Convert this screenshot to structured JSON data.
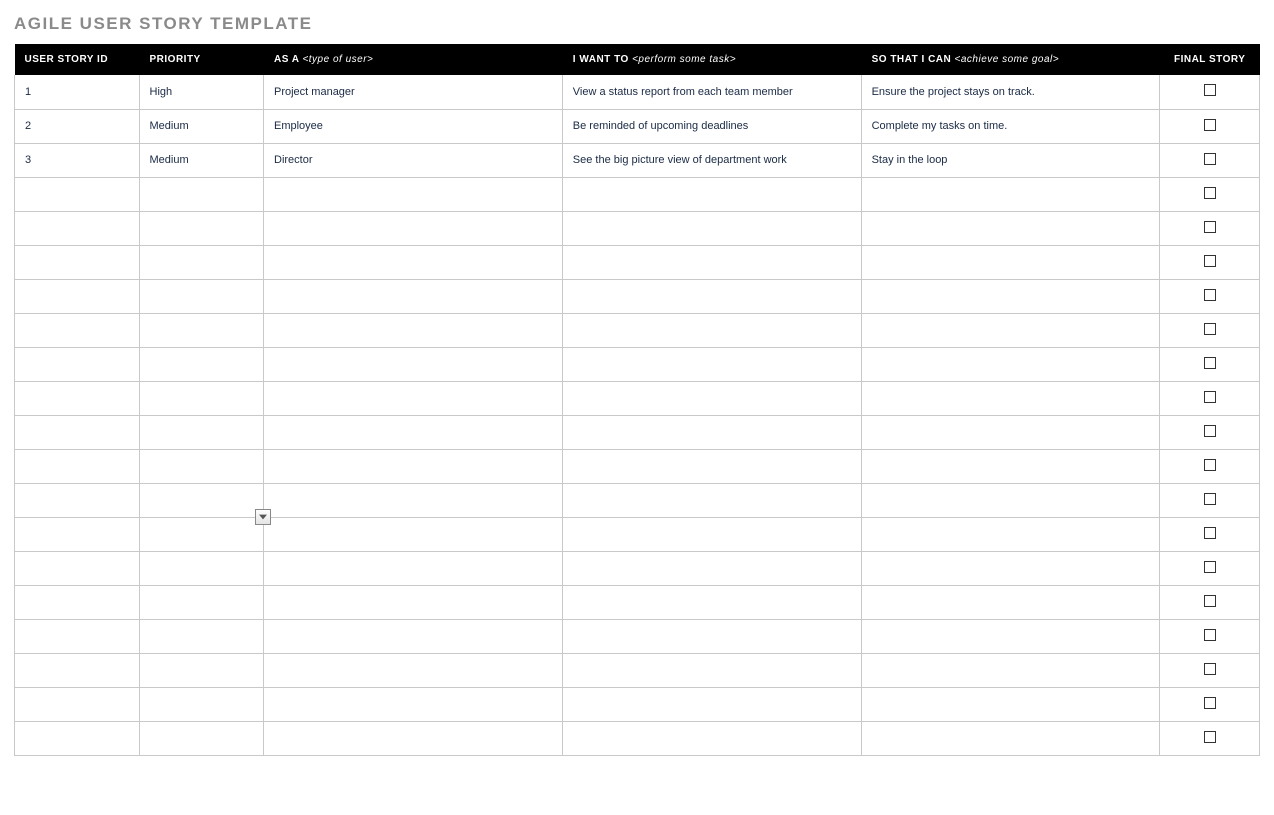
{
  "title": "AGILE USER STORY TEMPLATE",
  "headers": {
    "id": "USER STORY ID",
    "priority": "PRIORITY",
    "asa_label": "AS A ",
    "asa_hint": "<type of user>",
    "want_label": "I WANT TO ",
    "want_hint": "<perform some task>",
    "goal_label": "SO THAT I CAN ",
    "goal_hint": "<achieve some goal>",
    "final": "FINAL STORY"
  },
  "rows": [
    {
      "id": "1",
      "priority": "High",
      "asa": "Project manager",
      "want": "View a status report from each team member",
      "goal": "Ensure the project stays on track.",
      "checked": false
    },
    {
      "id": "2",
      "priority": "Medium",
      "asa": "Employee",
      "want": "Be reminded of upcoming deadlines",
      "goal": "Complete my tasks on time.",
      "checked": false
    },
    {
      "id": "3",
      "priority": "Medium",
      "asa": "Director",
      "want": "See the big picture view of department work",
      "goal": "Stay in the loop",
      "checked": false
    },
    {
      "id": "",
      "priority": "",
      "asa": "",
      "want": "",
      "goal": "",
      "checked": false
    },
    {
      "id": "",
      "priority": "",
      "asa": "",
      "want": "",
      "goal": "",
      "checked": false
    },
    {
      "id": "",
      "priority": "",
      "asa": "",
      "want": "",
      "goal": "",
      "checked": false
    },
    {
      "id": "",
      "priority": "",
      "asa": "",
      "want": "",
      "goal": "",
      "checked": false
    },
    {
      "id": "",
      "priority": "",
      "asa": "",
      "want": "",
      "goal": "",
      "checked": false
    },
    {
      "id": "",
      "priority": "",
      "asa": "",
      "want": "",
      "goal": "",
      "checked": false
    },
    {
      "id": "",
      "priority": "",
      "asa": "",
      "want": "",
      "goal": "",
      "checked": false
    },
    {
      "id": "",
      "priority": "",
      "asa": "",
      "want": "",
      "goal": "",
      "checked": false
    },
    {
      "id": "",
      "priority": "",
      "asa": "",
      "want": "",
      "goal": "",
      "checked": false
    },
    {
      "id": "",
      "priority": "",
      "asa": "",
      "want": "",
      "goal": "",
      "checked": false,
      "dropdown_on_priority": true
    },
    {
      "id": "",
      "priority": "",
      "asa": "",
      "want": "",
      "goal": "",
      "checked": false
    },
    {
      "id": "",
      "priority": "",
      "asa": "",
      "want": "",
      "goal": "",
      "checked": false
    },
    {
      "id": "",
      "priority": "",
      "asa": "",
      "want": "",
      "goal": "",
      "checked": false
    },
    {
      "id": "",
      "priority": "",
      "asa": "",
      "want": "",
      "goal": "",
      "checked": false
    },
    {
      "id": "",
      "priority": "",
      "asa": "",
      "want": "",
      "goal": "",
      "checked": false
    },
    {
      "id": "",
      "priority": "",
      "asa": "",
      "want": "",
      "goal": "",
      "checked": false
    },
    {
      "id": "",
      "priority": "",
      "asa": "",
      "want": "",
      "goal": "",
      "checked": false
    }
  ]
}
